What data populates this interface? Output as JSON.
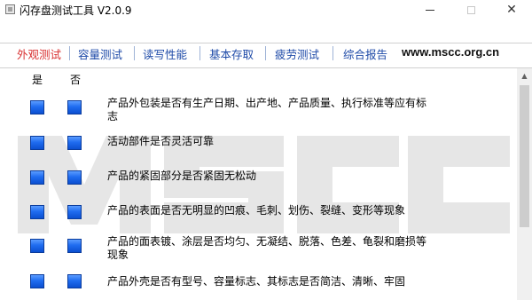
{
  "window": {
    "title": "闪存盘测试工具  V2.0.9",
    "min_label": "—",
    "max_label": "□",
    "close_label": "✕"
  },
  "tabs": [
    {
      "label": "外观测试",
      "active": true
    },
    {
      "label": "容量测试",
      "active": false
    },
    {
      "label": "读写性能",
      "active": false
    },
    {
      "label": "基本存取",
      "active": false
    },
    {
      "label": "疲劳测试",
      "active": false
    },
    {
      "label": "综合报告",
      "active": false
    }
  ],
  "brand": "www.mscc.org.cn",
  "columns": {
    "yes": "是",
    "no": "否"
  },
  "checks": [
    {
      "text": "产品外包装是否有生产日期、出产地、产品质量、执行标准等应有标志"
    },
    {
      "text": "活动部件是否灵活可靠"
    },
    {
      "text": "产品的紧固部分是否紧固无松动"
    },
    {
      "text": "产品的表面是否无明显的凹痕、毛刺、划伤、裂缝、变形等现象"
    },
    {
      "text": "产品的面表镀、涂层是否均匀、无凝结、脱落、色差、龟裂和磨损等现象"
    },
    {
      "text": "产品外壳是否有型号、容量标志、其标志是否简洁、清晰、牢固"
    }
  ],
  "colors": {
    "tab_text": "#1f4ba8",
    "tab_active": "#d83030",
    "checkbox": "#1f6cf0",
    "watermark": "#e6e6e6"
  }
}
